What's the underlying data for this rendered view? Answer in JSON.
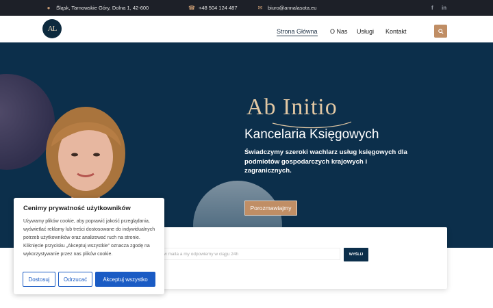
{
  "topbar": {
    "address": "Śląsk, Tarnowskie Góry, Dolna 1, 42-600",
    "phone": "+48 504 124 487",
    "email": "biuro@annalasota.eu",
    "social": [
      "f",
      "in"
    ]
  },
  "header": {
    "logo_text": "AL",
    "nav": [
      {
        "label": "Strona Główna",
        "active": true
      },
      {
        "label": "O Nas",
        "active": false
      },
      {
        "label": "Usługi",
        "active": false
      },
      {
        "label": "Kontakt",
        "active": false
      }
    ]
  },
  "hero": {
    "brand": "Ab Initio",
    "subtitle": "Kancelaria Księgowych",
    "description": "Świadczymy szeroki wachlarz usług księgowych dla podmiotów gospodarczych krajowych i zagranicznych.",
    "cta": "Porozmawiajmy"
  },
  "newsletter": {
    "placeholder": "w maila a my odpowiemy w ciągu 24h",
    "button": "WYŚLIJ"
  },
  "cookie": {
    "title": "Cenimy prywatność użytkowników",
    "body": "Używamy plików cookie, aby poprawić jakość przeglądania, wyświetlać reklamy lub treści dostosowane do indywidualnych potrzeb użytkowników oraz analizować ruch na stronie. Kliknięcie przycisku „Akceptuj wszystkie” oznacza zgodę na wykorzystywanie przez nas plików cookie.",
    "buttons": {
      "customize": "Dostosuj",
      "reject": "Odrzucać",
      "accept": "Akceptuj wszystko"
    }
  },
  "colors": {
    "navy": "#0c2f4b",
    "accent": "#c08e65",
    "dark": "#1d2028",
    "blue": "#1a5bc4"
  }
}
